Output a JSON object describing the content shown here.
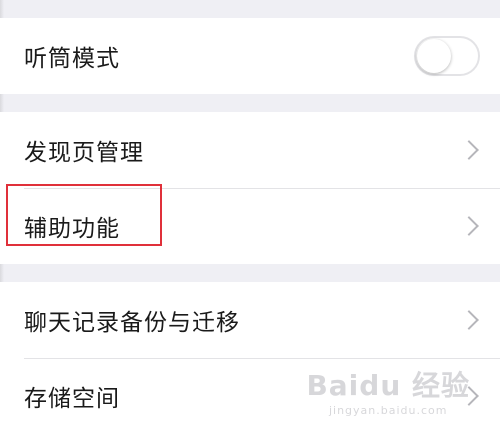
{
  "settings": {
    "group1": {
      "earpiece_mode": {
        "label": "听筒模式",
        "toggle_on": false
      }
    },
    "group2": {
      "discover_management": {
        "label": "发现页管理"
      },
      "accessibility": {
        "label": "辅助功能"
      }
    },
    "group3": {
      "chat_backup": {
        "label": "聊天记录备份与迁移"
      },
      "storage": {
        "label": "存储空间"
      }
    }
  },
  "highlight_color": "#e0303a",
  "watermark": {
    "main": "Baidu 经验",
    "sub": "jingyan.baidu.com"
  }
}
